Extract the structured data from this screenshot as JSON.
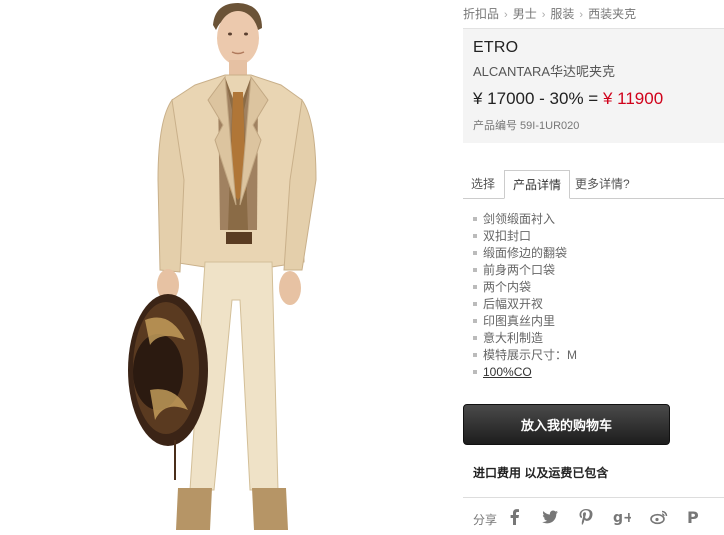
{
  "breadcrumb": {
    "items": [
      "折扣品",
      "男士",
      "服装",
      "西装夹克"
    ],
    "separator": "›"
  },
  "product": {
    "brand": "ETRO",
    "name": "ALCANTARA华达呢夹克",
    "price_text": "¥ 17000 - 30% = ",
    "final_price": "¥ 11900",
    "sku": "产品编号 59I-1UR020"
  },
  "tabs": [
    {
      "label": "选择"
    },
    {
      "label": "产品详情",
      "active": true
    },
    {
      "label": "更多详情?"
    }
  ],
  "details": [
    "剑领缎面衬入",
    "双扣封口",
    "缎面修边的翻袋",
    "前身两个口袋",
    "两个内袋",
    "后幅双开衩",
    "印图真丝内里",
    "意大利制造",
    "模特展示尺寸：M",
    "100%CO"
  ],
  "cart_button": "放入我的购物车",
  "shipping_note": "进口费用 以及运费已包含",
  "share": {
    "label": "分享",
    "icons": [
      "facebook-icon",
      "twitter-icon",
      "pinterest-icon",
      "google-plus-icon",
      "weibo-icon",
      "p-icon"
    ]
  },
  "colors": {
    "price_red": "#d0021b",
    "suit": "#e9d5b3",
    "button_dark": "#1d1d1d"
  }
}
